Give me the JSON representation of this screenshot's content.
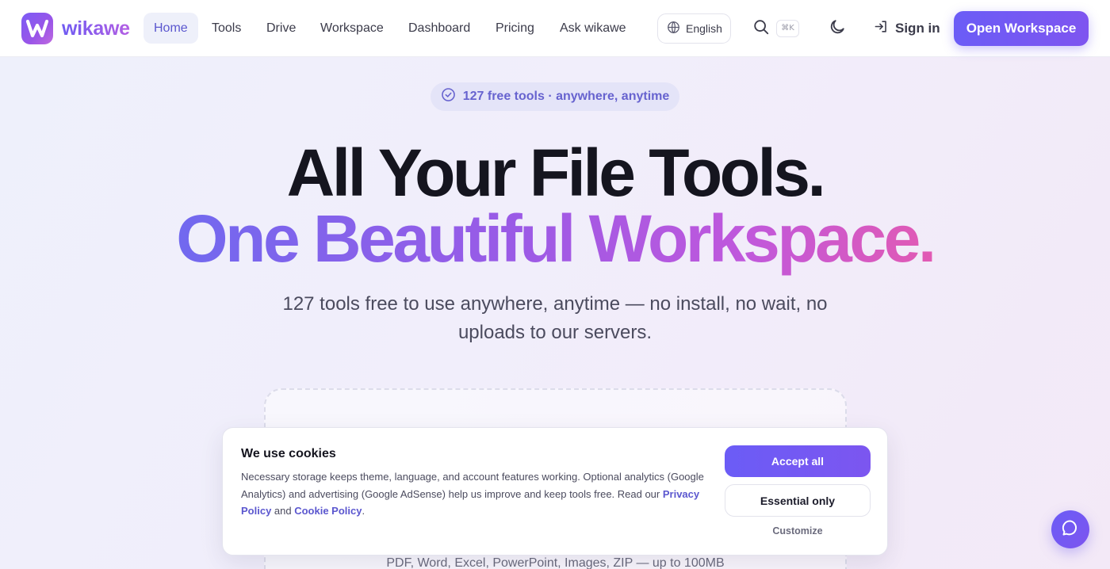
{
  "brand": {
    "name": "wikawe"
  },
  "nav": {
    "links": [
      {
        "label": "Home",
        "active": true
      },
      {
        "label": "Tools",
        "active": false
      },
      {
        "label": "Drive",
        "active": false
      },
      {
        "label": "Workspace",
        "active": false
      },
      {
        "label": "Dashboard",
        "active": false
      },
      {
        "label": "Pricing",
        "active": false
      },
      {
        "label": "Ask wikawe",
        "active": false
      }
    ],
    "language": "English",
    "search_shortcut": "⌘K",
    "sign_in": "Sign in",
    "cta": "Open Workspace",
    "icons": [
      "globe-icon",
      "search-icon",
      "moon-icon",
      "sign-in-icon"
    ]
  },
  "hero": {
    "pill": "127 free tools · anywhere, anytime",
    "headline_line1": "All Your File Tools.",
    "headline_line2": "One Beautiful Workspace.",
    "subtitle": "127 tools free to use anywhere, anytime — no install, no wait, no uploads to our servers."
  },
  "dropzone": {
    "hint": "PDF, Word, Excel, PowerPoint, Images, ZIP — up to 100MB"
  },
  "cookie_banner": {
    "title": "We use cookies",
    "text_before": "Necessary storage keeps theme, language, and account features working. Optional analytics (Google Analytics) and advertising (Google AdSense) help us improve and keep tools free. Read our ",
    "privacy_link": "Privacy Policy",
    "and": " and ",
    "cookie_link": "Cookie Policy",
    "period": ".",
    "accept_all": "Accept all",
    "essential_only": "Essential only",
    "customize": "Customize"
  },
  "colors": {
    "accent": "#6b5cf6",
    "accent_text": "#5b57cf",
    "gradient_end": "#e25ab3"
  }
}
